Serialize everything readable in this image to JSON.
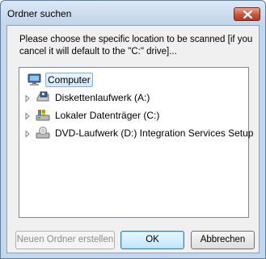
{
  "dialog": {
    "title": "Ordner suchen",
    "prompt": "Please choose the specific location to be scanned [if you cancel it will default to the \"C:\" drive]..."
  },
  "tree": {
    "root": {
      "label": "Computer",
      "icon": "computer-icon",
      "selected": true
    },
    "children": [
      {
        "label": "Diskettenlaufwerk (A:)",
        "icon": "floppy-drive-icon"
      },
      {
        "label": "Lokaler Datenträger (C:)",
        "icon": "hard-drive-icon"
      },
      {
        "label": "DVD-Laufwerk (D:) Integration Services Setup",
        "icon": "dvd-drive-icon"
      }
    ]
  },
  "buttons": {
    "new_folder": "Neuen Ordner erstellen",
    "ok": "OK",
    "cancel": "Abbrechen"
  },
  "colors": {
    "close_button": "#c8553c",
    "selection_border": "#84acdd",
    "default_button_border": "#3c7fb1"
  }
}
